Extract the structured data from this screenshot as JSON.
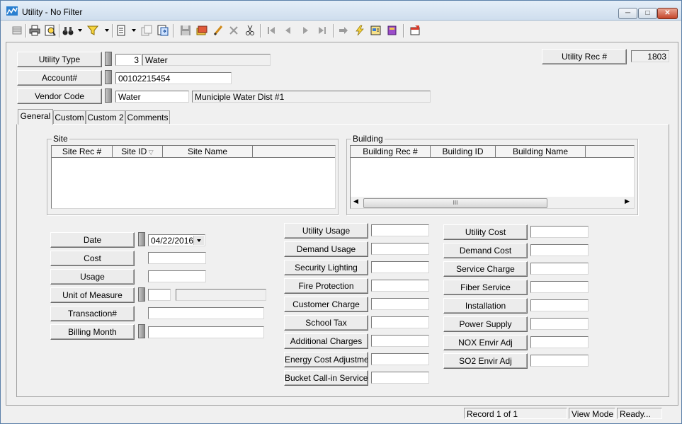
{
  "window": {
    "title": "Utility - No Filter",
    "controls": {
      "minimize": "─",
      "maximize": "□",
      "close": "✕"
    }
  },
  "toolbar": {
    "icons": [
      "grid-view-icon",
      "print-icon",
      "print-preview-icon",
      "binoculars-icon",
      "filter-icon",
      "new-record-icon",
      "copy-record-icon",
      "import-icon",
      "save-icon",
      "undo-icon",
      "edit-icon",
      "delete-icon",
      "cut-icon",
      "first-record-icon",
      "previous-record-icon",
      "next-record-icon",
      "last-record-icon",
      "goto-icon",
      "lightning-icon",
      "report-icon",
      "book-icon",
      "exit-icon"
    ]
  },
  "header": {
    "utility_type": {
      "label": "Utility Type",
      "code": "3",
      "name": "Water"
    },
    "account": {
      "label": "Account#",
      "value": "00102215454"
    },
    "vendor": {
      "label": "Vendor Code",
      "code": "Water",
      "name": "Municiple Water Dist #1"
    },
    "utility_rec": {
      "label": "Utility Rec #",
      "value": "1803"
    }
  },
  "tabs": [
    "General",
    "Custom",
    "Custom 2",
    "Comments"
  ],
  "site": {
    "title": "Site",
    "columns": [
      "Site Rec #",
      "Site ID",
      "Site Name"
    ]
  },
  "building": {
    "title": "Building",
    "columns": [
      "Building Rec #",
      "Building ID",
      "Building Name"
    ],
    "scroll_thumb": "III"
  },
  "left_fields": {
    "date": {
      "label": "Date",
      "value": "04/22/2016"
    },
    "cost": {
      "label": "Cost",
      "value": ""
    },
    "usage": {
      "label": "Usage",
      "value": ""
    },
    "unit_of_measure": {
      "label": "Unit of Measure",
      "code": "",
      "name": ""
    },
    "transaction": {
      "label": "Transaction#",
      "value": ""
    },
    "billing_month": {
      "label": "Billing Month",
      "value": ""
    }
  },
  "middle_fields": [
    {
      "label": "Utility Usage",
      "value": ""
    },
    {
      "label": "Demand Usage",
      "value": ""
    },
    {
      "label": "Security Lighting",
      "value": ""
    },
    {
      "label": "Fire Protection",
      "value": ""
    },
    {
      "label": "Customer Charge",
      "value": ""
    },
    {
      "label": "School Tax",
      "value": ""
    },
    {
      "label": "Additional Charges",
      "value": ""
    },
    {
      "label": "Energy Cost Adjustment",
      "value": ""
    },
    {
      "label": "Bucket Call-in Service",
      "value": ""
    }
  ],
  "right_fields": [
    {
      "label": "Utility Cost",
      "value": ""
    },
    {
      "label": "Demand Cost",
      "value": ""
    },
    {
      "label": "Service Charge",
      "value": ""
    },
    {
      "label": "Fiber Service",
      "value": ""
    },
    {
      "label": "Installation",
      "value": ""
    },
    {
      "label": "Power Supply",
      "value": ""
    },
    {
      "label": "NOX Envir Adj",
      "value": ""
    },
    {
      "label": "SO2 Envir Adj",
      "value": ""
    }
  ],
  "status": {
    "record": "Record 1 of 1",
    "mode": "View Mode",
    "state": "Ready..."
  }
}
